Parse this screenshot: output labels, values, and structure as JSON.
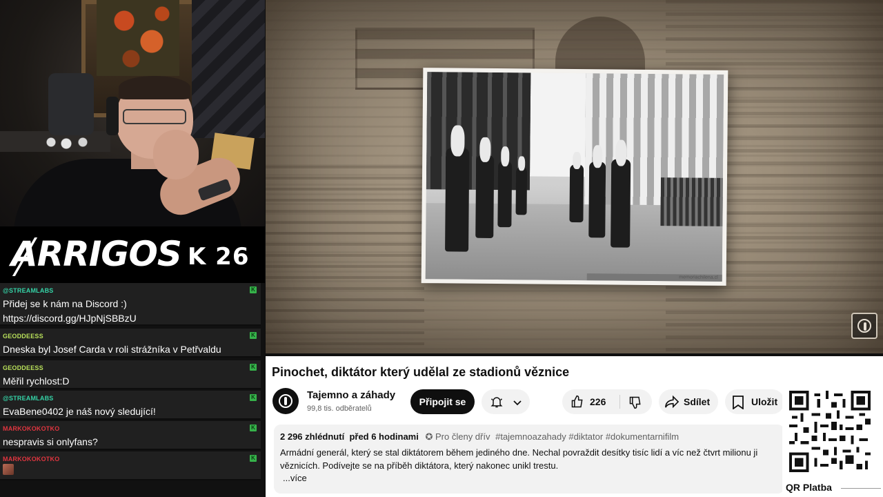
{
  "stream": {
    "logo_text": "ARRIGOS",
    "logo_tag": "K 26"
  },
  "chat": {
    "messages": [
      {
        "user": "@STREAMLABS",
        "user_color": "#35d3a7",
        "text": "Přidej se k nám na Discord :)\nhttps://discord.gg/HJpNjSBBzU"
      },
      {
        "user": "GEODDEESS",
        "user_color": "#b8e05a",
        "text": "Dneska byl Josef Carda v roli strážníka v Petřvaldu"
      },
      {
        "user": "GEODDEESS",
        "user_color": "#b8e05a",
        "text": "Měřil rychlost:D"
      },
      {
        "user": "@STREAMLABS",
        "user_color": "#35d3a7",
        "text": "EvaBene0402 je náš nový sledující!"
      },
      {
        "user": "MARKOKOKOTKO",
        "user_color": "#e0353f",
        "text": "nespravis si onlyfans?"
      },
      {
        "user": "MARKOKOKOTKO",
        "user_color": "#e0353f",
        "text": ""
      }
    ]
  },
  "video": {
    "photo_watermark": "memoriachilena.cl",
    "title": "Pinochet, diktátor který udělal ze stadionů věznice",
    "channel_name": "Tajemno a záhady",
    "subscribers": "99,8 tis. odběratelů",
    "join_label": "Připojit se",
    "likes": "226",
    "share_label": "Sdílet",
    "save_label": "Uložit",
    "views": "2 296 zhlédnutí",
    "age": "před 6 hodinami",
    "members_label": "Pro členy dřív",
    "hashtags": "#tajemnoazahady #diktator #dokumentarnifilm",
    "description_line1": "Armádní generál, který se stal diktátorem během jediného dne. Nechal povraždit desítky tisíc lidí a víc než čtvrt milionu ji",
    "description_line2": "věznicích. Podívejte se na příběh diktátora, který nakonec unikl trestu.",
    "more_label": "...více"
  },
  "qr": {
    "label": "QR Platba"
  }
}
